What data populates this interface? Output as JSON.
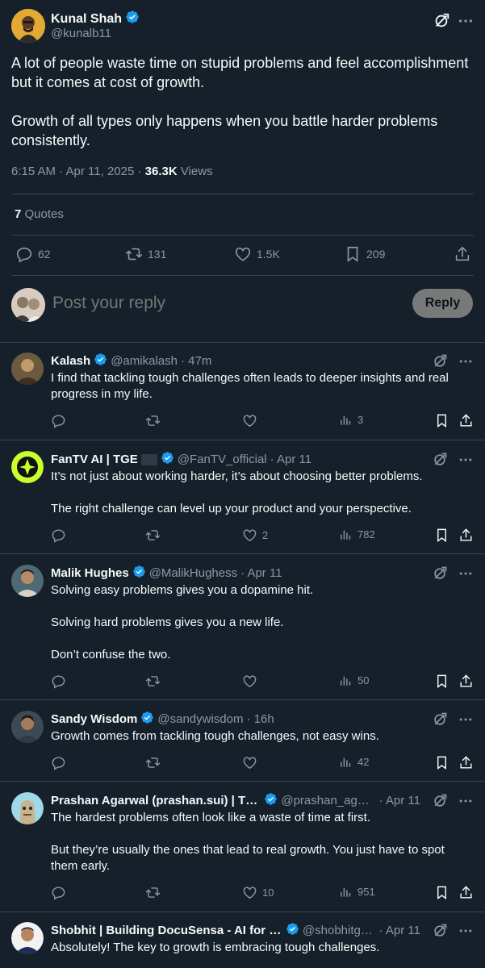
{
  "main_tweet": {
    "author_name": "Kunal Shah",
    "author_handle": "@kunalb11",
    "text_p1": "A lot of people waste time on stupid problems and feel accomplishment but it comes at cost of growth.",
    "text_p2": "Growth of all types only happens when you battle harder problems consistently.",
    "timestamp": "6:15 AM · Apr 11, 2025 · ",
    "views_count": "36.3K",
    "views_label": " Views",
    "quotes_count": "7",
    "quotes_label": " Quotes",
    "reply_count": "62",
    "retweet_count": "131",
    "like_count": "1.5K",
    "bookmark_count": "209"
  },
  "composer": {
    "placeholder": "Post your reply",
    "reply_button": "Reply"
  },
  "replies": [
    {
      "name": "Kalash",
      "handle": "@amikalash",
      "time": "· 47m",
      "paragraphs": [
        "I find that tackling tough challenges often leads to deeper insights and real progress in my life."
      ],
      "likes": "",
      "views": "3"
    },
    {
      "name": "FanTV AI | TGE",
      "handle": "@FanTV_official",
      "time": "· Apr 11",
      "paragraphs": [
        "It’s not just about working harder, it’s about choosing better problems.",
        "The right challenge can level up your product and your perspective."
      ],
      "likes": "2",
      "views": "782"
    },
    {
      "name": "Malik Hughes",
      "handle": "@MalikHughess",
      "time": "· Apr 11",
      "paragraphs": [
        "Solving easy problems gives you a dopamine hit.",
        "Solving hard problems gives you a new life.",
        "Don’t confuse the two."
      ],
      "likes": "",
      "views": "50"
    },
    {
      "name": "Sandy Wisdom",
      "handle": "@sandywisdom",
      "time": "· 16h",
      "paragraphs": [
        "Growth comes from tackling tough challenges, not easy wins."
      ],
      "likes": "",
      "views": "42"
    },
    {
      "name": "Prashan Agarwal (prashan.sui) | TG...",
      "handle": "@prashan_agar...",
      "time": "· Apr 11",
      "paragraphs": [
        "The hardest problems often look like a waste of time at first.",
        "But they’re usually the ones that lead to real growth. You just have to spot them early."
      ],
      "likes": "10",
      "views": "951"
    },
    {
      "name": "Shobhit | Building DocuSensa - AI for D...",
      "handle": "@shobhitgu...",
      "time": "· Apr 11",
      "paragraphs": [
        "Absolutely! The key to growth is embracing tough challenges."
      ],
      "likes": "",
      "views": ""
    }
  ],
  "icons": {
    "grok": "grok-icon",
    "more": "more-icon",
    "reply": "reply-icon",
    "retweet": "retweet-icon",
    "like": "like-icon",
    "views": "views-icon",
    "bookmark": "bookmark-icon",
    "share": "share-icon",
    "verified": "verified-badge-icon"
  },
  "colors": {
    "background": "#15202b",
    "text": "#f7f9f9",
    "muted": "#8b98a5",
    "verified": "#1d9bf0",
    "divider": "#38444d",
    "reply_button": "#787a7a"
  }
}
